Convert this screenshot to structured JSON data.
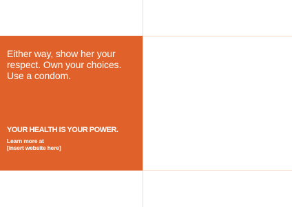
{
  "colors": {
    "panel_background": "#e0622a",
    "panel_text": "#ffffff",
    "page_background": "#ffffff",
    "guide_lines": "#f3d8c6"
  },
  "panel": {
    "message_lines": [
      "Either way, show her your",
      "respect. Own your choices.",
      "Use a condom."
    ],
    "tagline": "YOUR HEALTH IS YOUR POWER.",
    "learn_more_lines": [
      "Learn more at",
      "[insert website here]"
    ]
  }
}
